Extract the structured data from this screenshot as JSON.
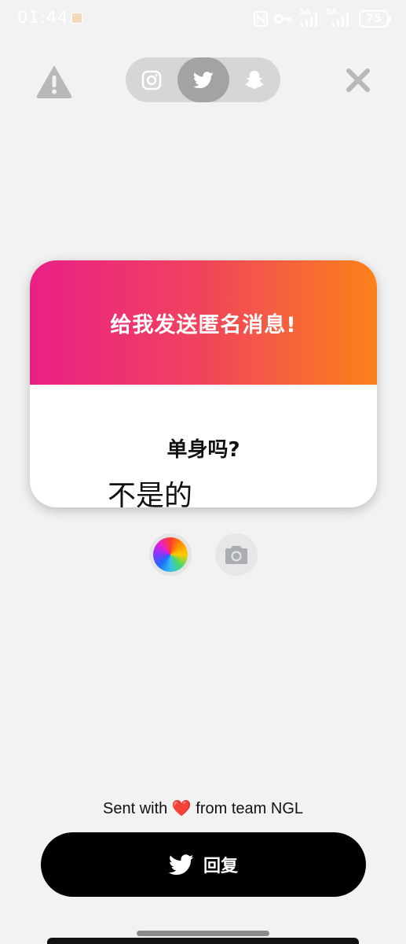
{
  "status_bar": {
    "time": "01:44",
    "network_1": "5A",
    "network_2": "5A",
    "battery": "75",
    "icons": [
      "nfc-icon",
      "key-icon",
      "signal-icon",
      "signal-icon",
      "battery-icon"
    ]
  },
  "top_bar": {
    "warning_icon": "warning-icon",
    "close_icon": "close-icon",
    "social_tabs": [
      {
        "name": "instagram",
        "icon": "instagram-icon",
        "selected": false
      },
      {
        "name": "twitter",
        "icon": "twitter-icon",
        "selected": true
      },
      {
        "name": "snapchat",
        "icon": "snapchat-icon",
        "selected": false
      }
    ]
  },
  "card": {
    "title": "给我发送匿名消息!",
    "question": "单身吗?",
    "answer": "不是的",
    "gradient_colors": [
      "#ea1f86",
      "#f0445c",
      "#fb8219"
    ]
  },
  "tools": {
    "color_icon": "color-wheel-icon",
    "camera_icon": "camera-icon"
  },
  "footer": {
    "prefix": "Sent with",
    "heart": "❤️",
    "suffix": "from team NGL"
  },
  "reply_button": {
    "label": "回复",
    "icon": "twitter-icon"
  }
}
